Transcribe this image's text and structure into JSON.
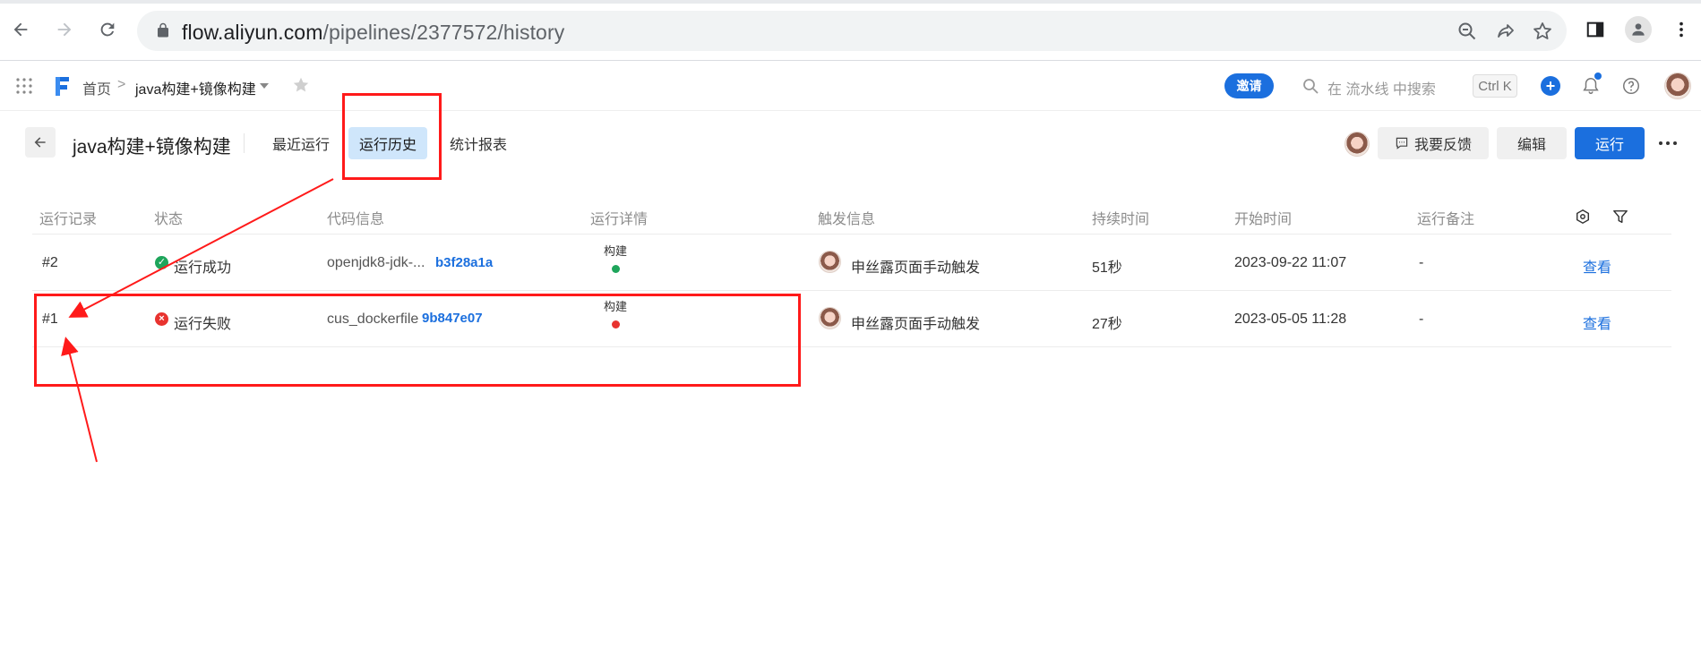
{
  "browser": {
    "url_host": "flow.aliyun.com",
    "url_path": "/pipelines/2377572/history"
  },
  "header": {
    "breadcrumb_home": "首页",
    "breadcrumb_separator": ">",
    "breadcrumb_current": "java构建+镜像构建",
    "invite_label": "邀请",
    "search_placeholder": "在 流水线 中搜索",
    "search_shortcut": "Ctrl K"
  },
  "pipeline": {
    "title": "java构建+镜像构建",
    "tabs": [
      {
        "label": "最近运行",
        "active": false
      },
      {
        "label": "运行历史",
        "active": true
      },
      {
        "label": "统计报表",
        "active": false
      }
    ],
    "feedback_label": "我要反馈",
    "edit_label": "编辑",
    "run_label": "运行"
  },
  "table": {
    "columns": [
      "运行记录",
      "状态",
      "代码信息",
      "运行详情",
      "触发信息",
      "持续时间",
      "开始时间",
      "运行备注"
    ],
    "rows": [
      {
        "record": "#2",
        "status": "运行成功",
        "status_color": "#1ea55b",
        "code_branch": "openjdk8-jdk-...",
        "commit": "b3f28a1a",
        "stage_name": "构建",
        "stage_color": "#1ea55b",
        "trigger_user": "申丝露",
        "trigger_text": "页面手动触发",
        "duration": "51秒",
        "start_time": "2023-09-22 11:07",
        "note": "-",
        "action": "查看"
      },
      {
        "record": "#1",
        "status": "运行失败",
        "status_color": "#e8332f",
        "code_branch": "cus_dockerfile",
        "commit": "9b847e07",
        "stage_name": "构建",
        "stage_color": "#e8332f",
        "trigger_user": "申丝露",
        "trigger_text": "页面手动触发",
        "duration": "27秒",
        "start_time": "2023-05-05 11:28",
        "note": "-",
        "action": "查看"
      }
    ]
  },
  "colors": {
    "primary": "#1b6fde",
    "annotation": "#ff1a1a",
    "active_tab_bg": "#cfe6fb"
  }
}
